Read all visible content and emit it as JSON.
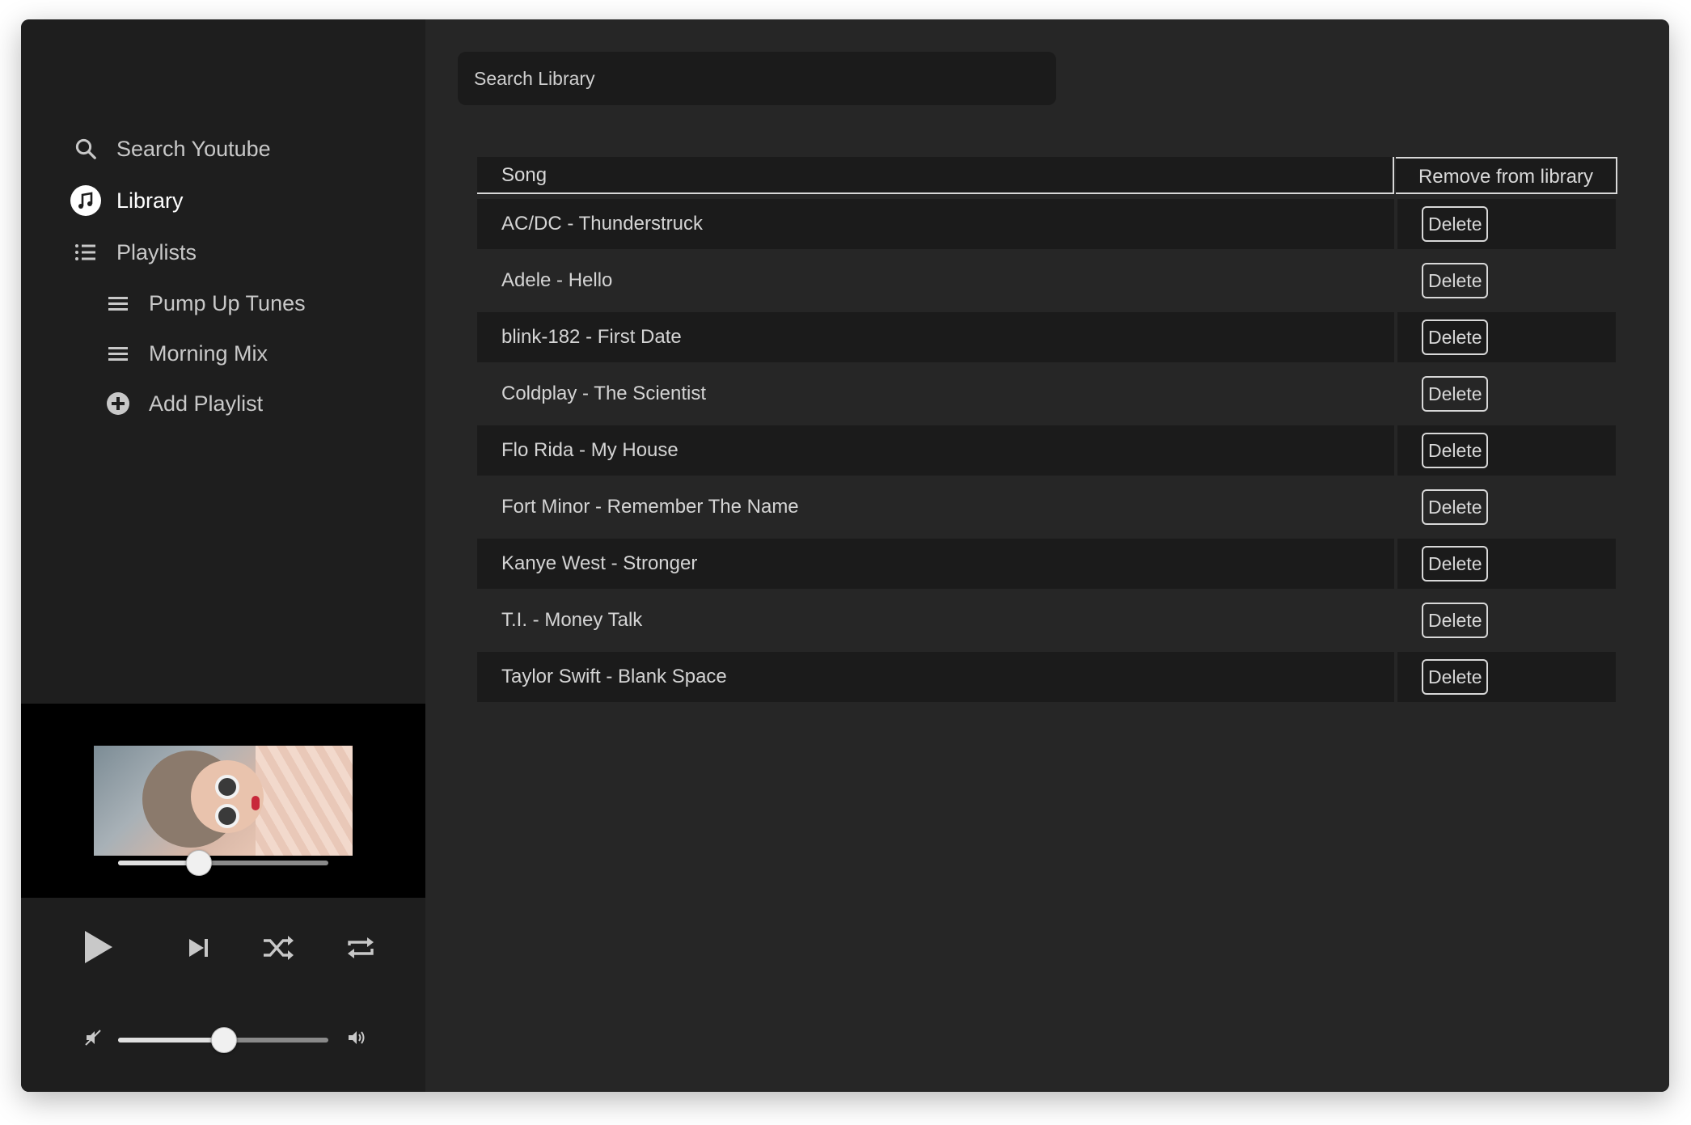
{
  "sidebar": {
    "nav": [
      {
        "label": "Search Youtube",
        "icon": "search-icon"
      },
      {
        "label": "Library",
        "icon": "music-note-icon"
      },
      {
        "label": "Playlists",
        "icon": "list-icon"
      }
    ],
    "playlists": [
      {
        "label": "Pump Up Tunes",
        "icon": "menu-icon"
      },
      {
        "label": "Morning Mix",
        "icon": "menu-icon"
      }
    ],
    "add_playlist": {
      "label": "Add Playlist",
      "icon": "plus-circle-icon"
    }
  },
  "player": {
    "progress": 0.38,
    "volume": 0.5
  },
  "main": {
    "search_placeholder": "Search Library",
    "table": {
      "headers": {
        "song": "Song",
        "remove": "Remove from library"
      },
      "delete_label": "Delete",
      "rows": [
        "AC/DC - Thunderstruck",
        "Adele - Hello",
        "blink-182 - First Date",
        "Coldplay - The Scientist",
        "Flo Rida - My House",
        "Fort Minor - Remember The Name",
        "Kanye West - Stronger",
        "T.I. - Money Talk",
        "Taylor Swift - Blank Space"
      ]
    }
  },
  "colors": {
    "window_bg": "#262626",
    "sidebar_bg": "#1e1e1e",
    "row_dark": "#1b1b1b",
    "text": "#d4d4d4"
  }
}
